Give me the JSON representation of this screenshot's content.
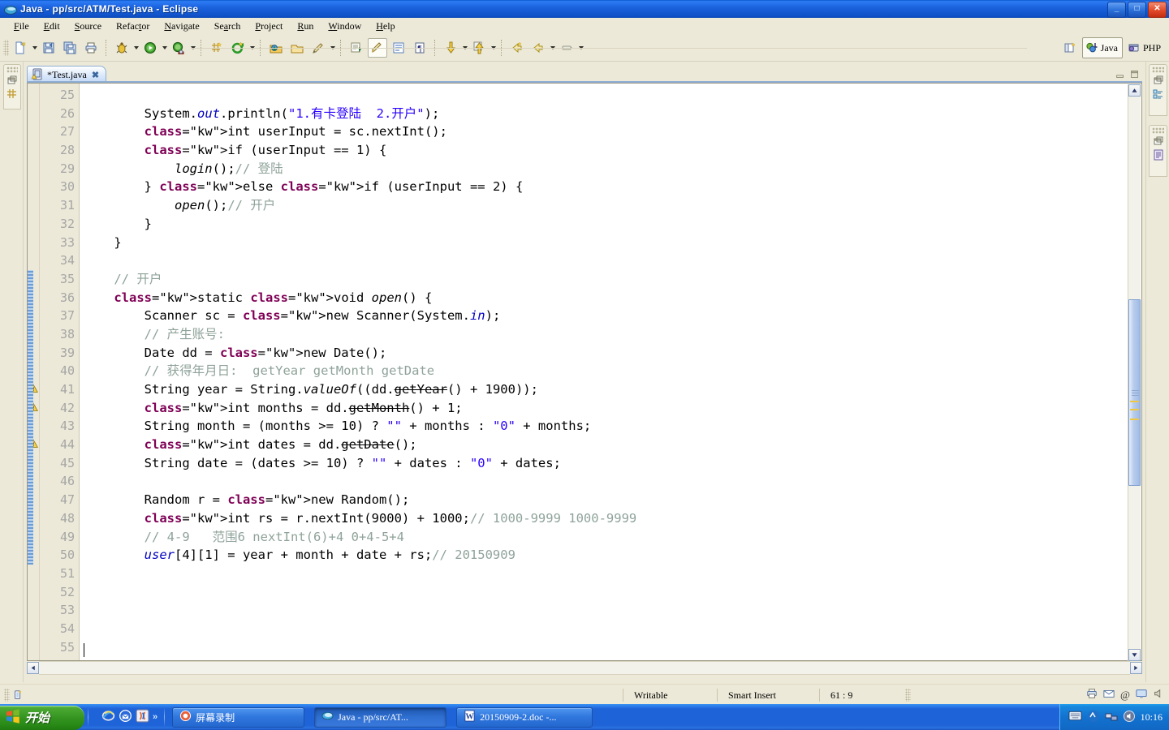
{
  "window": {
    "title": "Java - pp/src/ATM/Test.java - Eclipse",
    "icon": "eclipse-moon-icon",
    "buttons": [
      {
        "name": "minimize",
        "glyph": "_"
      },
      {
        "name": "maximize",
        "glyph": "□"
      },
      {
        "name": "close",
        "glyph": "✕"
      }
    ]
  },
  "menubar": {
    "items": [
      {
        "label": "File",
        "mnemonic": "F"
      },
      {
        "label": "Edit",
        "mnemonic": "E"
      },
      {
        "label": "Source",
        "mnemonic": "S"
      },
      {
        "label": "Refactor",
        "mnemonic": "t"
      },
      {
        "label": "Navigate",
        "mnemonic": "N"
      },
      {
        "label": "Search",
        "mnemonic": "a"
      },
      {
        "label": "Project",
        "mnemonic": "P"
      },
      {
        "label": "Run",
        "mnemonic": "R"
      },
      {
        "label": "Window",
        "mnemonic": "W"
      },
      {
        "label": "Help",
        "mnemonic": "H"
      }
    ]
  },
  "toolbar": {
    "groups": [
      [
        "new-wizard-icon",
        "dropdown",
        "save-icon",
        "save-all-icon",
        "print-icon"
      ],
      [
        "debug-icon",
        "dropdown",
        "run-icon",
        "dropdown",
        "external-tools-icon",
        "dropdown"
      ],
      [
        "new-java-package-icon",
        "new-java-class-icon",
        "dropdown"
      ],
      [
        "open-type-icon",
        "open-task-icon",
        "search-icon",
        "dropdown"
      ],
      [
        "next-annotation-icon",
        "toggle-mark-occurrences-icon",
        "show-whitespace-icon",
        "toggle-block-selection-icon"
      ],
      [
        "next-edit-location-icon",
        "dropdown",
        "previous-edit-location-icon",
        "dropdown"
      ],
      [
        "back-icon",
        "dropdown",
        "forward-icon",
        "dropdown",
        "pin-editor-icon",
        "dropdown"
      ]
    ],
    "perspectives": {
      "open_perspective_icon": "open-perspective-icon",
      "items": [
        {
          "label": "Java",
          "icon": "java-perspective-icon",
          "active": true
        },
        {
          "label": "PHP",
          "icon": "php-perspective-icon",
          "active": false
        }
      ]
    }
  },
  "editor": {
    "tab": {
      "label": "*Test.java",
      "icon": "java-file-warning-icon",
      "close_glyph": "✖",
      "dirty": true
    },
    "minimize_icon": "minimize-view-icon",
    "maximize_icon": "maximize-view-icon",
    "first_line": 25,
    "lines": [
      {
        "n": 25,
        "code": ""
      },
      {
        "n": 26,
        "code": "        System.out.println(\"1.有卡登陆  2.开户\");"
      },
      {
        "n": 27,
        "code": "        int userInput = sc.nextInt();"
      },
      {
        "n": 28,
        "code": "        if (userInput == 1) {"
      },
      {
        "n": 29,
        "code": "            login();// 登陆"
      },
      {
        "n": 30,
        "code": "        } else if (userInput == 2) {"
      },
      {
        "n": 31,
        "code": "            open();// 开户"
      },
      {
        "n": 32,
        "code": "        }"
      },
      {
        "n": 33,
        "code": "    }"
      },
      {
        "n": 34,
        "code": ""
      },
      {
        "n": 35,
        "code": "    // 开户"
      },
      {
        "n": 36,
        "code": "    static void open() {"
      },
      {
        "n": 37,
        "code": "        Scanner sc = new Scanner(System.in);"
      },
      {
        "n": 38,
        "code": "        // 产生账号:"
      },
      {
        "n": 39,
        "code": "        Date dd = new Date();"
      },
      {
        "n": 40,
        "code": "        // 获得年月日:  getYear getMonth getDate"
      },
      {
        "n": 41,
        "code": "        String year = String.valueOf((dd.getYear() + 1900));"
      },
      {
        "n": 42,
        "code": "        int months = dd.getMonth() + 1;"
      },
      {
        "n": 43,
        "code": "        String month = (months >= 10) ? \"\" + months : \"0\" + months;"
      },
      {
        "n": 44,
        "code": "        int dates = dd.getDate();"
      },
      {
        "n": 45,
        "code": "        String date = (dates >= 10) ? \"\" + dates : \"0\" + dates;"
      },
      {
        "n": 46,
        "code": ""
      },
      {
        "n": 47,
        "code": "        Random r = new Random();"
      },
      {
        "n": 48,
        "code": "        int rs = r.nextInt(9000) + 1000;// 1000-9999 1000-9999"
      },
      {
        "n": 49,
        "code": "        // 4-9   范围6 nextInt(6)+4 0+4-5+4"
      },
      {
        "n": 50,
        "code": "        user[4][1] = year + month + date + rs;// 20150909"
      },
      {
        "n": 51,
        "code": ""
      },
      {
        "n": 52,
        "code": ""
      },
      {
        "n": 53,
        "code": ""
      },
      {
        "n": 54,
        "code": ""
      },
      {
        "n": 55,
        "code": ""
      }
    ],
    "warning_lines": [
      41,
      42,
      44
    ],
    "warning_icon": "warning-marker-icon",
    "colors": {
      "keyword": "#7f0055",
      "string": "#2a00ff",
      "comment": "#8fa39a",
      "field": "#0000c0",
      "linenumber": "#a6a6a6",
      "background": "#ffffff"
    },
    "scroll": {
      "up_glyph": "▲",
      "down_glyph": "▼",
      "left_glyph": "◀",
      "right_glyph": "▶"
    }
  },
  "statusbar": {
    "lock_icon": "editor-state-icon",
    "writable": "Writable",
    "insert_mode": "Smart Insert",
    "position": "61 : 9",
    "right_icons": [
      "printer-icon",
      "mail-icon",
      "at-icon",
      "screen-icon",
      "volume-icon"
    ]
  },
  "taskbar": {
    "start_label": "开始",
    "start_icon": "windows-flag-icon",
    "quicklaunch": [
      {
        "name": "internet-explorer-icon"
      },
      {
        "name": "outlook-express-icon"
      },
      {
        "name": "media-player-icon"
      },
      {
        "name": "show-more-icon",
        "glyph": "»"
      }
    ],
    "tasks": [
      {
        "label": "屏幕录制",
        "icon": "screen-recorder-icon",
        "active": false
      },
      {
        "label": "Java - pp/src/AT...",
        "icon": "eclipse-moon-icon",
        "active": true
      },
      {
        "label": "20150909-2.doc -...",
        "icon": "word-doc-icon",
        "active": false
      }
    ],
    "tray": {
      "icons": [
        "keyboard-icon",
        "language-bar-icon",
        "network-icon",
        "volume-icon"
      ],
      "time": "10:16"
    }
  }
}
